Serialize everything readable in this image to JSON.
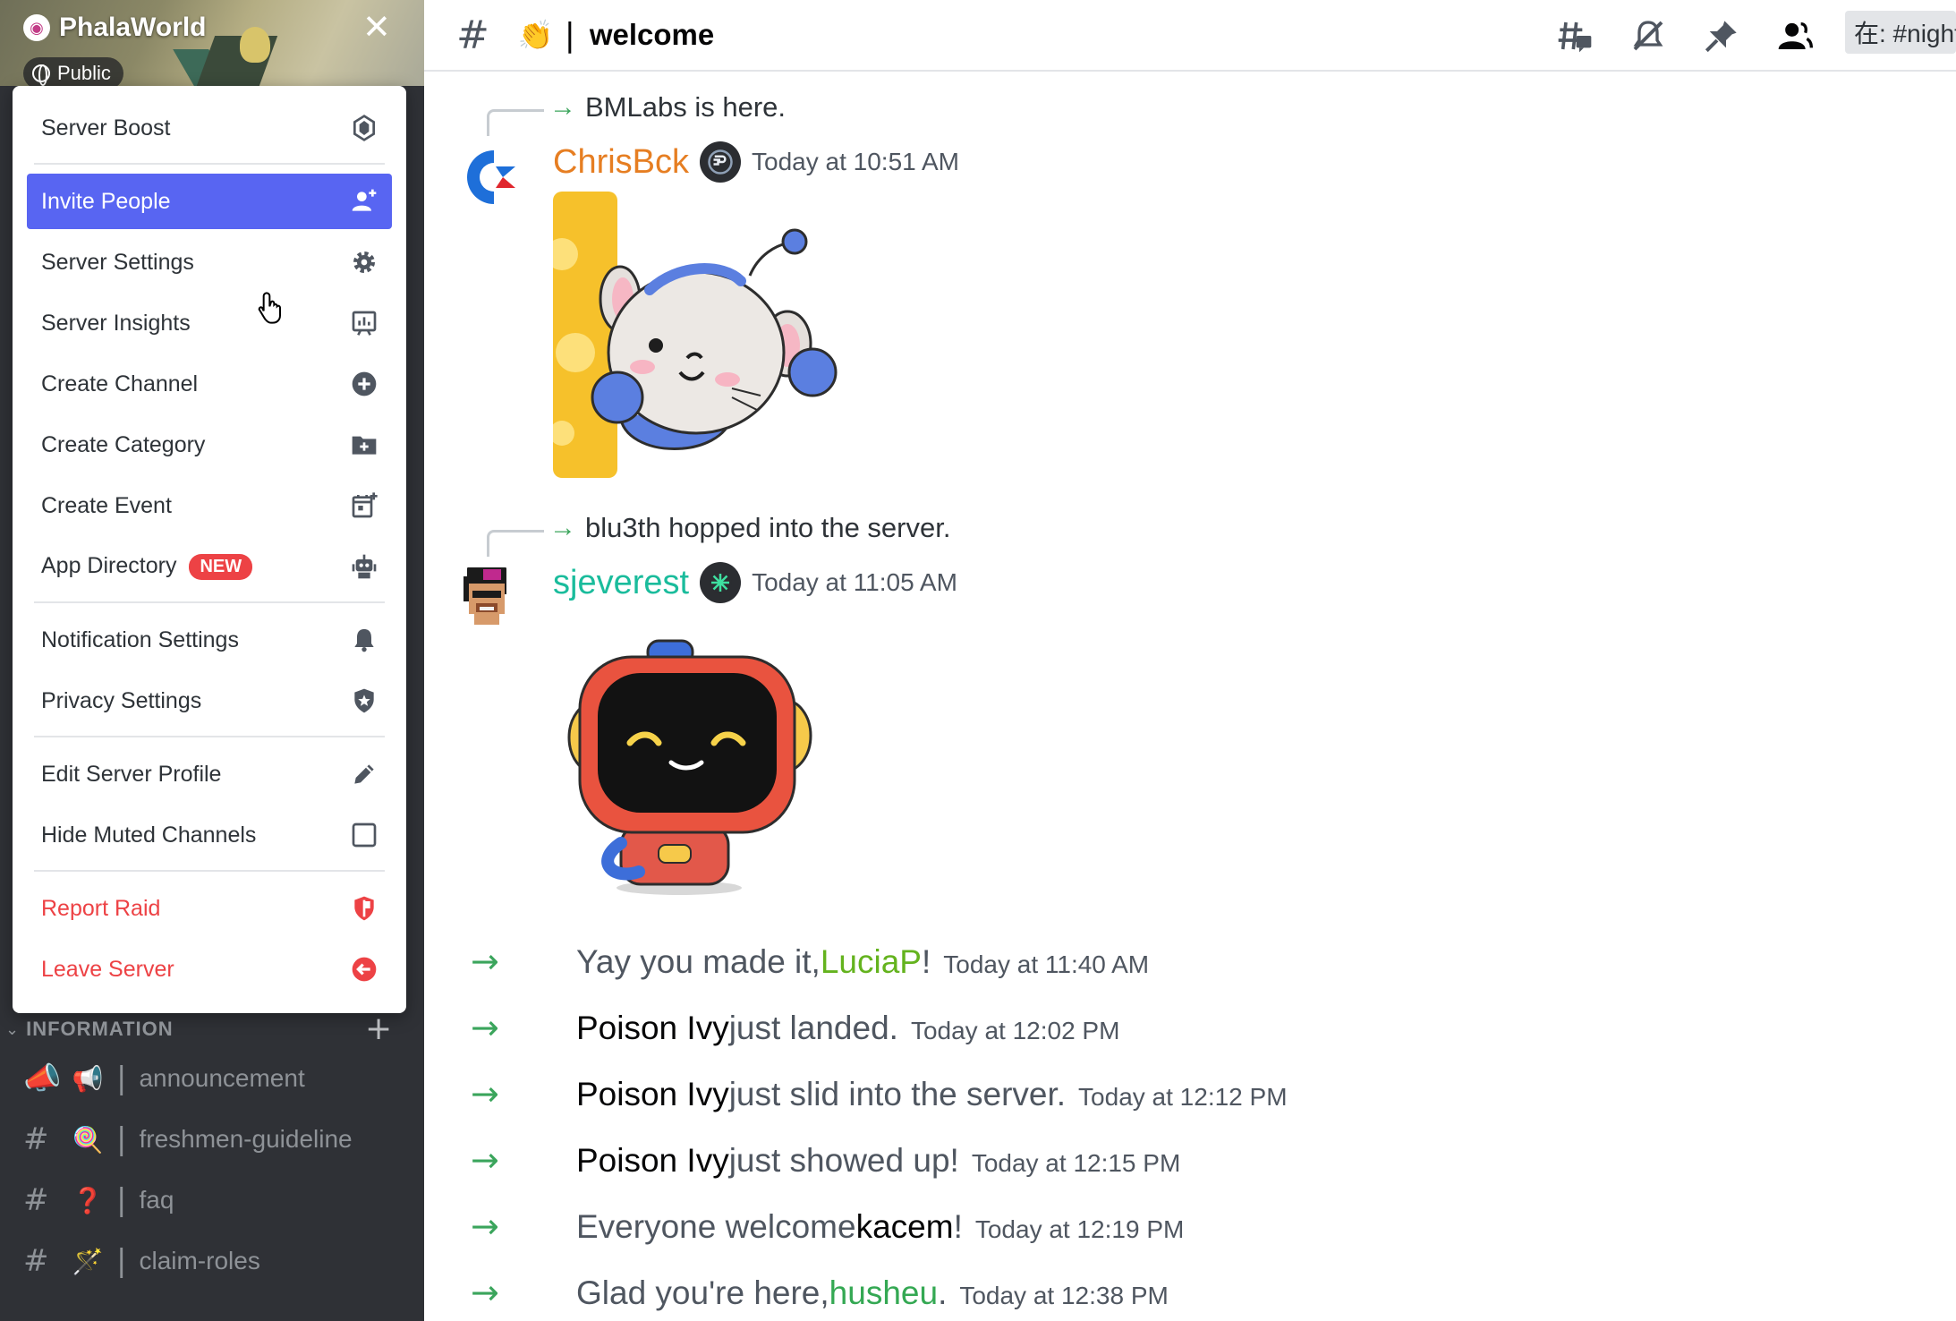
{
  "server": {
    "name": "PhalaWorld",
    "visibility": "Public",
    "close_icon": "close-icon"
  },
  "menu": {
    "items": [
      {
        "label": "Server Boost",
        "icon": "boost-gem-icon"
      },
      {
        "label": "Invite People",
        "icon": "add-user-icon"
      },
      {
        "label": "Server Settings",
        "icon": "gear-icon"
      },
      {
        "label": "Server Insights",
        "icon": "insights-chart-icon"
      },
      {
        "label": "Create Channel",
        "icon": "plus-circle-icon"
      },
      {
        "label": "Create Category",
        "icon": "folder-plus-icon"
      },
      {
        "label": "Create Event",
        "icon": "calendar-plus-icon"
      },
      {
        "label": "App Directory",
        "icon": "robot-icon",
        "badge": "NEW"
      },
      {
        "label": "Notification Settings",
        "icon": "bell-icon"
      },
      {
        "label": "Privacy Settings",
        "icon": "shield-star-icon"
      },
      {
        "label": "Edit Server Profile",
        "icon": "pencil-icon"
      },
      {
        "label": "Hide Muted Channels",
        "icon": "checkbox-icon"
      },
      {
        "label": "Report Raid",
        "icon": "shield-flag-icon"
      },
      {
        "label": "Leave Server",
        "icon": "leave-arrow-icon"
      }
    ]
  },
  "channels": {
    "category": "INFORMATION",
    "items": [
      {
        "emoji": "📢",
        "name": "announcement"
      },
      {
        "emoji": "🍭",
        "name": "freshmen-guideline"
      },
      {
        "emoji": "❓",
        "name": "faq"
      },
      {
        "emoji": "🪄",
        "name": "claim-roles"
      }
    ]
  },
  "header": {
    "emoji": "👏",
    "bar": "|",
    "title": "welcome",
    "search_text": "在: #night"
  },
  "messages": [
    {
      "system_text": "BMLabs is here.",
      "author": "ChrisBck",
      "author_color": "#e67e22",
      "timestamp": "Today at 10:51 AM"
    },
    {
      "system_text": "blu3th hopped into the server.",
      "author": "sjeverest",
      "author_color": "#1abc9c",
      "timestamp": "Today at 11:05 AM"
    }
  ],
  "welcomes": [
    {
      "pre": "Yay you made it, ",
      "name": "LuciaP",
      "post": "!",
      "timestamp": "Today at 11:40 AM",
      "name_color": "#64b31e"
    },
    {
      "pre": "",
      "name": "Poison Ivy",
      "post": " just landed.",
      "timestamp": "Today at 12:02 PM",
      "name_color": "#060607"
    },
    {
      "pre": "",
      "name": "Poison Ivy",
      "post": " just slid into the server.",
      "timestamp": "Today at 12:12 PM",
      "name_color": "#060607"
    },
    {
      "pre": "",
      "name": "Poison Ivy",
      "post": " just showed up!",
      "timestamp": "Today at 12:15 PM",
      "name_color": "#060607"
    },
    {
      "pre": "Everyone welcome ",
      "name": "kacem",
      "post": "!",
      "timestamp": "Today at 12:19 PM",
      "name_color": "#060607"
    },
    {
      "pre": "Glad you're here, ",
      "name": "husheu",
      "post": ".",
      "timestamp": "Today at 12:38 PM",
      "name_color": "#34a853"
    }
  ],
  "colors": {
    "accent": "#5865f2",
    "danger": "#ed4245",
    "join_arrow": "#3ba55c"
  }
}
